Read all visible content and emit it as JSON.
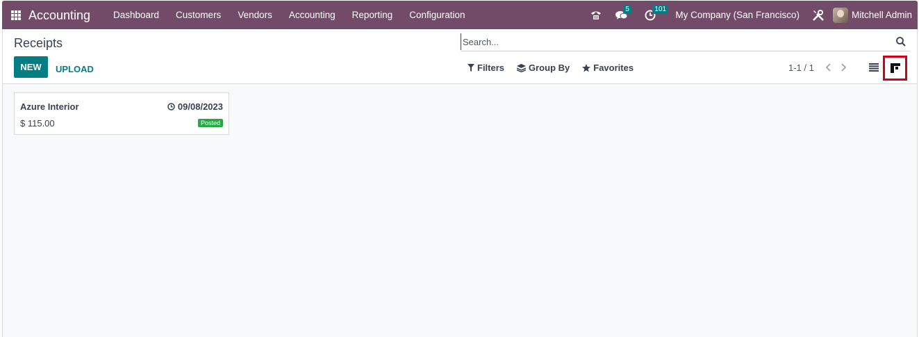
{
  "navbar": {
    "app_title": "Accounting",
    "menu": [
      "Dashboard",
      "Customers",
      "Vendors",
      "Accounting",
      "Reporting",
      "Configuration"
    ],
    "messages_count": "5",
    "activities_count": "101",
    "company": "My Company (San Francisco)",
    "user": "Mitchell Admin"
  },
  "control_panel": {
    "title": "Receipts",
    "new_label": "NEW",
    "upload_label": "UPLOAD",
    "search_placeholder": "Search...",
    "filters_label": "Filters",
    "groupby_label": "Group By",
    "favorites_label": "Favorites",
    "pager": "1-1 / 1"
  },
  "records": [
    {
      "partner": "Azure Interior",
      "date": "09/08/2023",
      "amount": "$ 115.00",
      "status": "Posted"
    }
  ],
  "colors": {
    "brand": "#714b67",
    "primary": "#017e84",
    "status_posted": "#28a745",
    "highlight": "#d4001a"
  }
}
